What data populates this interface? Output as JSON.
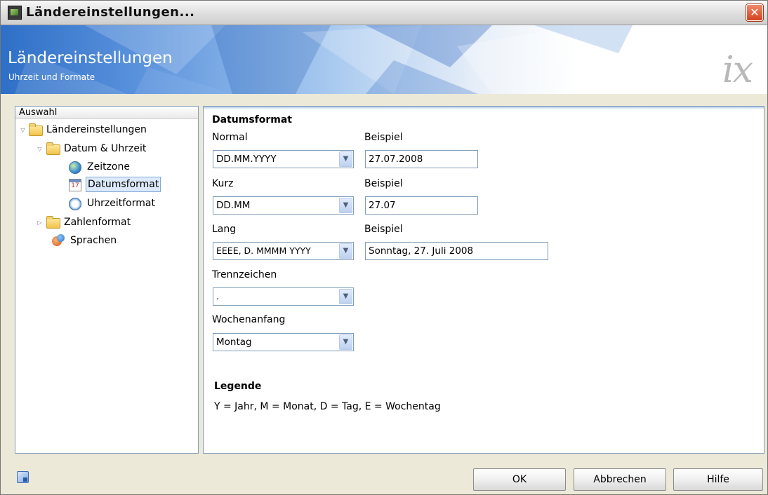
{
  "window": {
    "title": "Ländereinstellungen..."
  },
  "banner": {
    "title": "Ländereinstellungen",
    "subtitle": "Uhrzeit und Formate",
    "logo": "ix"
  },
  "tree": {
    "header": "Auswahl",
    "nodes": [
      {
        "label": "Ländereinstellungen",
        "icon": "folder-icon",
        "expanded": true
      },
      {
        "label": "Datum & Uhrzeit",
        "icon": "folder-icon",
        "expanded": true
      },
      {
        "label": "Zeitzone",
        "icon": "globe-icon"
      },
      {
        "label": "Datumsformat",
        "icon": "calendar-icon",
        "selected": true
      },
      {
        "label": "Uhrzeitformat",
        "icon": "clock-icon"
      },
      {
        "label": "Zahlenformat",
        "icon": "folder-icon",
        "expanded": false
      },
      {
        "label": "Sprachen",
        "icon": "language-icon"
      }
    ]
  },
  "form": {
    "section_title": "Datumsformat",
    "normal": {
      "label": "Normal",
      "value": "DD.MM.YYYY",
      "example_label": "Beispiel",
      "example": "27.07.2008"
    },
    "kurz": {
      "label": "Kurz",
      "value": "DD.MM",
      "example_label": "Beispiel",
      "example": "27.07"
    },
    "lang": {
      "label": "Lang",
      "value": "EEEE, D. MMMM YYYY",
      "example_label": "Beispiel",
      "example": "Sonntag, 27. Juli 2008"
    },
    "trennzeichen": {
      "label": "Trennzeichen",
      "value": "."
    },
    "wochenanfang": {
      "label": "Wochenanfang",
      "value": "Montag"
    }
  },
  "legend": {
    "title": "Legende",
    "text": "Y = Jahr, M = Monat, D = Tag, E = Wochentag"
  },
  "buttons": {
    "ok": "OK",
    "cancel": "Abbrechen",
    "help": "Hilfe"
  },
  "colors": {
    "window_bg": "#ece9d8",
    "banner_blue": "#2e6fc7",
    "border": "#7f9db9",
    "close_red": "#d5411e"
  }
}
